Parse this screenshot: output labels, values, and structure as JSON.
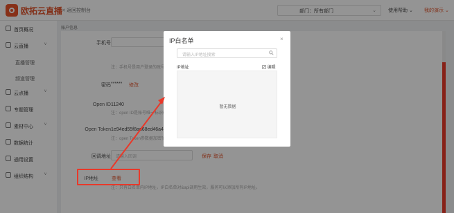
{
  "header": {
    "logo_text": "欧拓云直播",
    "back_label": "< 返回控制台",
    "dept_label": "部门：所有部门",
    "help_label": "使用帮助",
    "user_label": "我的演示"
  },
  "sidebar": {
    "items": [
      {
        "label": "首页概况",
        "icon": "home-icon",
        "arrow": ""
      },
      {
        "label": "云直播",
        "icon": "live-icon",
        "arrow": "v"
      },
      {
        "label": "直播管理",
        "icon": "",
        "arrow": ""
      },
      {
        "label": "频道管理",
        "icon": "",
        "arrow": ""
      },
      {
        "label": "云点播",
        "icon": "vod-icon",
        "arrow": "v"
      },
      {
        "label": "专题管理",
        "icon": "topic-icon",
        "arrow": ""
      },
      {
        "label": "素材中心",
        "icon": "material-icon",
        "arrow": "v"
      },
      {
        "label": "数据统计",
        "icon": "stats-icon",
        "arrow": ""
      },
      {
        "label": "通用设置",
        "icon": "settings-icon",
        "arrow": ""
      },
      {
        "label": "组织结构",
        "icon": "org-icon",
        "arrow": "v"
      }
    ]
  },
  "main": {
    "tab": "账户信息",
    "phone_label": "手机号",
    "phone_hint": "注：手机号是用户登录的账号 - 1点，绑",
    "password_label": "密码",
    "password_value": "******",
    "password_action": "修改",
    "openid_label": "Open ID",
    "openid_value": "11240",
    "openid_hint": "注：open ID是账号唯一标识码",
    "token_label": "Open Token",
    "token_value": "1e94ed55f8ad68ed46a4e0e",
    "token_hint": "注：open Token参数据加密验证",
    "callback_label": "回调地址",
    "callback_placeholder": "请输入回调",
    "save_label": "保存",
    "cancel_label": "取消",
    "ip_label": "IP地址",
    "ip_action": "查看",
    "ip_hint": "注：只有白名单内IP地址，IP白名单对&api调用生效，服务可以添加所有IP地址。"
  },
  "modal": {
    "title": "IP白名单",
    "close": "×",
    "search_placeholder": "请输入IP地址搜索",
    "column_header": "IP地址",
    "edit_label": "编辑",
    "empty_text": "暂无数据"
  },
  "colors": {
    "accent": "#e0532b",
    "annotation": "#e8392a"
  }
}
